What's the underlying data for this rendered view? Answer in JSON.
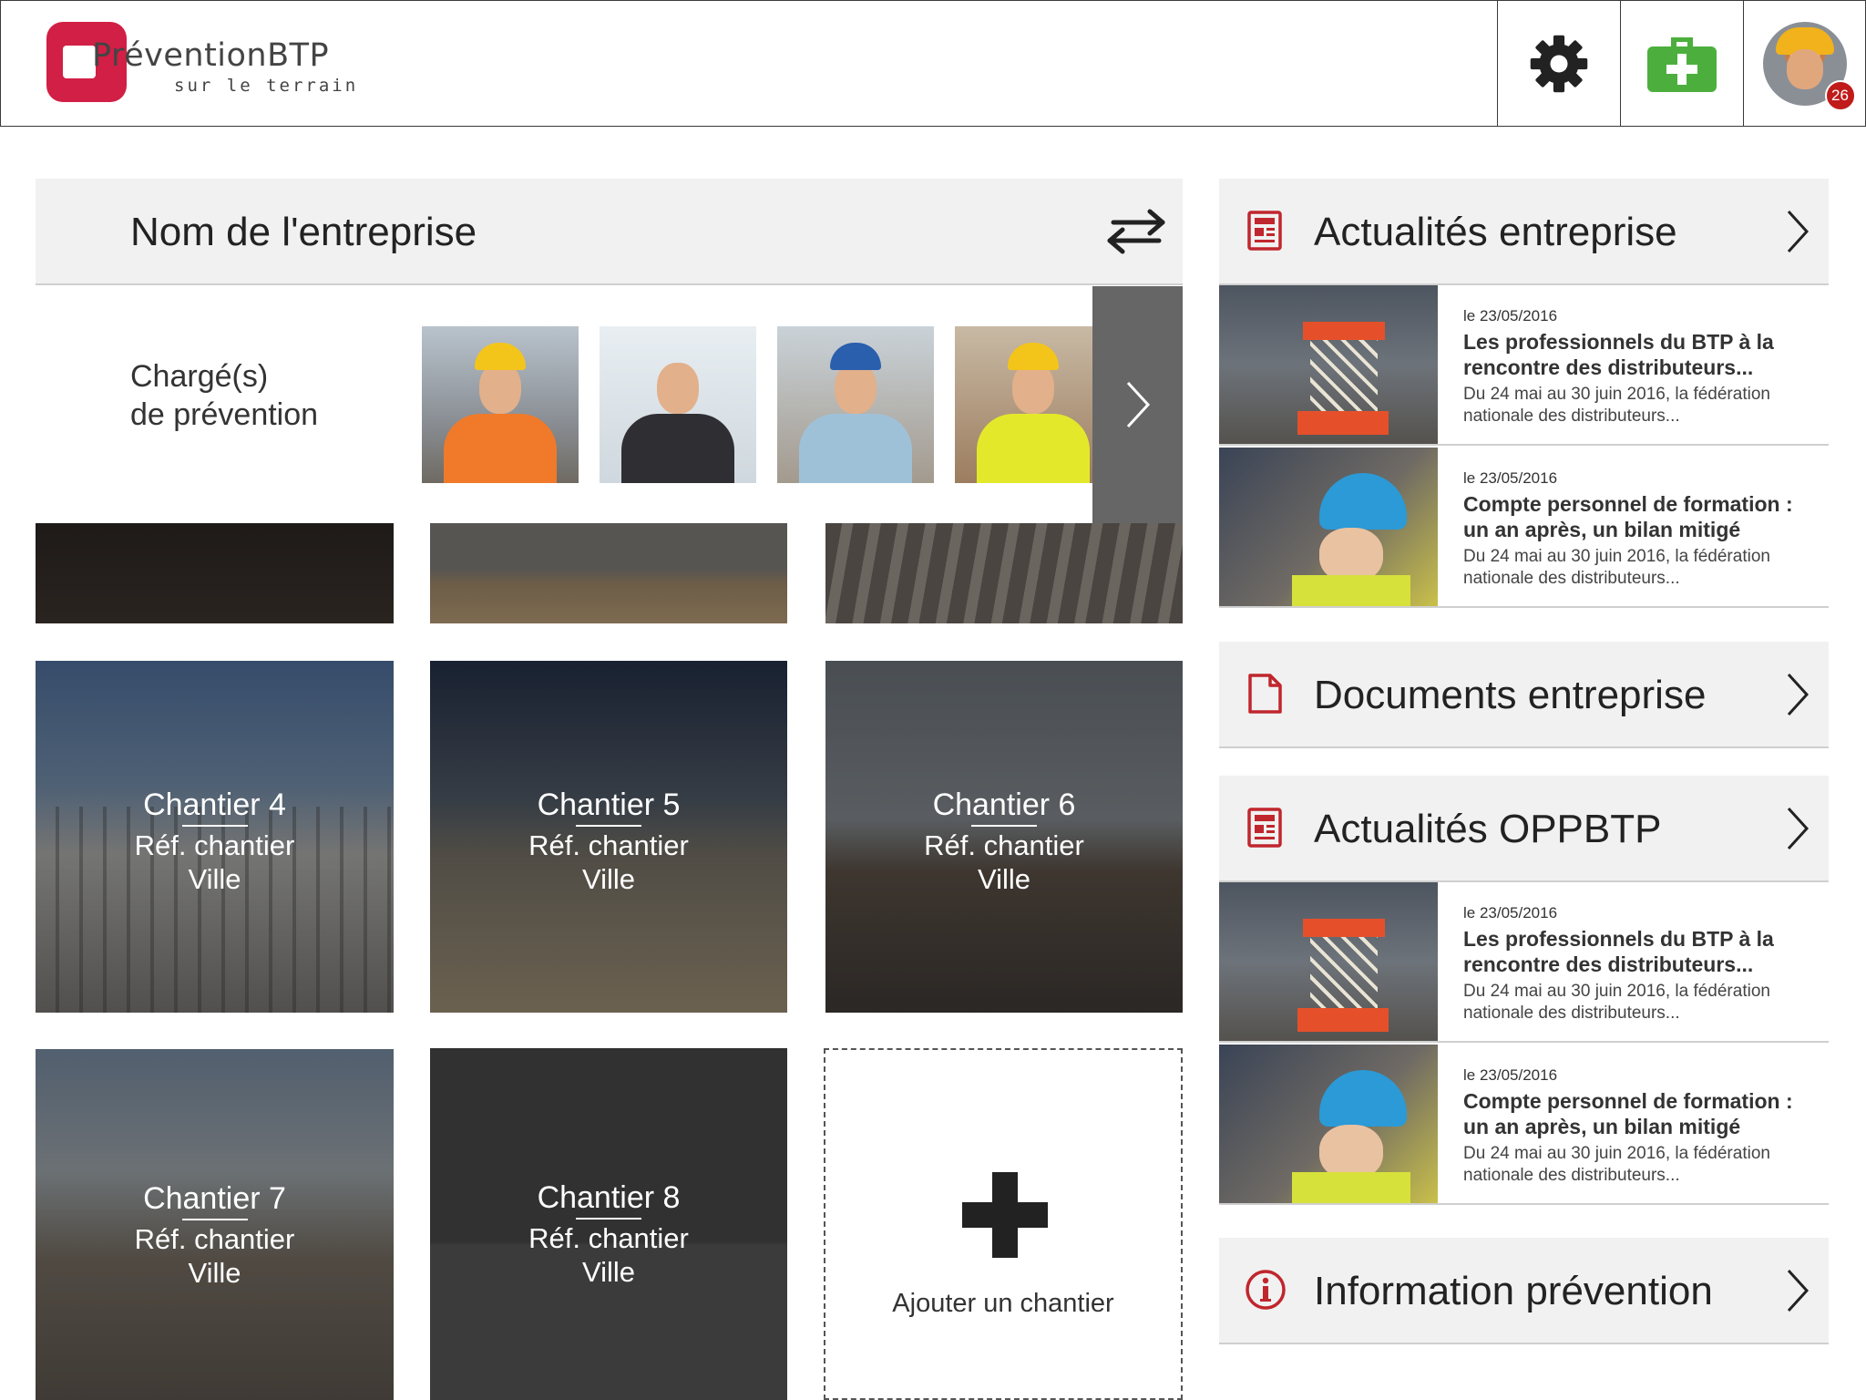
{
  "header": {
    "logo_name": "PréventionBTP",
    "logo_tagline": "sur le terrain",
    "notifications_count": "26"
  },
  "company": {
    "name": "Nom de l'entreprise",
    "preventers_label_line1": "Chargé(s)",
    "preventers_label_line2": "de prévention"
  },
  "sites": [
    {
      "title": "Chantier 4",
      "ref": "Réf. chantier",
      "city": "Ville"
    },
    {
      "title": "Chantier 5",
      "ref": "Réf. chantier",
      "city": "Ville"
    },
    {
      "title": "Chantier 6",
      "ref": "Réf. chantier",
      "city": "Ville"
    },
    {
      "title": "Chantier 7",
      "ref": "Réf. chantier",
      "city": "Ville"
    },
    {
      "title": "Chantier 8",
      "ref": "Réf. chantier",
      "city": "Ville"
    }
  ],
  "add_site_label": "Ajouter un chantier",
  "right": {
    "news_company_title": "Actualités entreprise",
    "documents_title": "Documents entreprise",
    "news_oppbtp_title": "Actualités OPPBTP",
    "info_title": "Information prévention",
    "news_company": [
      {
        "date": "le 23/05/2016",
        "title": "Les professionnels du BTP à la rencontre des distributeurs...",
        "desc": "Du 24 mai au 30 juin 2016, la fédération nationale des distributeurs..."
      },
      {
        "date": "le 23/05/2016",
        "title": "Compte personnel de formation : un an après, un bilan mitigé",
        "desc": "Du 24 mai au 30 juin 2016, la fédération nationale des distributeurs..."
      }
    ],
    "news_oppbtp": [
      {
        "date": "le 23/05/2016",
        "title": "Les professionnels du BTP à la rencontre des distributeurs...",
        "desc": "Du 24 mai au 30 juin 2016, la fédération nationale des distributeurs..."
      },
      {
        "date": "le 23/05/2016",
        "title": "Compte personnel de formation : un an après, un bilan mitigé",
        "desc": "Du 24 mai au 30 juin 2016, la fédération nationale des distributeurs..."
      }
    ]
  },
  "colors": {
    "brand": "#d21f45",
    "first_aid": "#4caf3d",
    "icon_red": "#c0262d",
    "badge": "#c01a1a"
  }
}
